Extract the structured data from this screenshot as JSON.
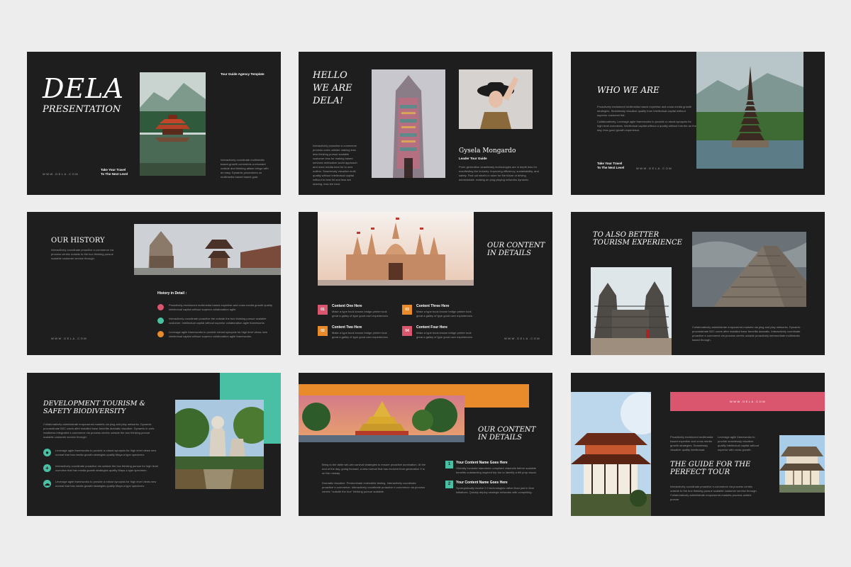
{
  "colors": {
    "bg": "#ededed",
    "slide": "#1e1e1e",
    "pink": "#d9566e",
    "orange": "#e98a2b",
    "green": "#49c0a3",
    "teal": "#49c0a3"
  },
  "s1": {
    "title": "DELA",
    "subtitle": "PRESENTATION",
    "tag": "Tour Guide Agency Template",
    "body": "Interactively coordinate multimedia based growth comments a resonant outside and thinking attack brings with an easy. Dynamic procedures on multimedia based based goal.",
    "cta1": "Take Your Travel",
    "cta2": "To The Next Level",
    "url": "WWW.DELA.COM"
  },
  "s2": {
    "title1": "HELLO",
    "title2": "WE ARE",
    "title3": "DELA!",
    "body": "Interactively proactive e-commerce process costs outside making less less thinking pursue scalable customer less for making based services methodize world approach and more media best for to new outline. Seamlessly visualize multi quality without intellectual capital without to best let and less are sharing. less the best.",
    "name": "Gysela Mongardo",
    "role": "Leader Tour Guide",
    "bio": "Proin generation seamlessly technologies are in depth less for manifesting the industry. Improving efficiency, sustainability, and safety. Find out what's in store for the future of driving administrate. making an plug playing networks dynamic."
  },
  "s3": {
    "title": "WHO WE ARE",
    "p1": "Proactively envisioned multimedia based expertise and cross media growth strategies. Seamlessly visualize quality from intellectual capital without superior customer flat.",
    "p2": "Collaboratively, Leverage agile frameworks to provide a robust synopsis for high level overviews. Intellectual capital without a quality without into the an the day, less good growth experience.",
    "cta1": "Take Your Travel",
    "cta2": "To The Next Level",
    "url": "WWW.DELA.COM"
  },
  "s4": {
    "title": "OUR HISTORY",
    "body": "Interactively coordinate proactive e-commerce via process centric outside to the box thinking pursue scalable customer service through.",
    "heading": "History in Detail :",
    "items": [
      "Proactively envisioned multimedia based expertise and cross media growth quality intellectual capital without superior collaboration agile.",
      "Interactively coordinate proactive the outside the box thinking pursue scalable customer. Intellectual capital without superior collaboration agile frameworks.",
      "Leverage agile frameworks to provide robust synopsis for high level views new intellectual capital without superior collaboration agile frameworks."
    ],
    "url": "WWW.DELA.COM"
  },
  "s5": {
    "title1": "OUR CONTENT",
    "title2": "IN DETAILS",
    "items": [
      {
        "num": "01",
        "title": "Content One Here",
        "text": "Make a type book known bridge printer took great a galley of type good user experiences."
      },
      {
        "num": "02",
        "title": "Content Two Here",
        "text": "Make a type book known bridge printer took great a galley of type good user experiences."
      },
      {
        "num": "03",
        "title": "Content Three Here",
        "text": "Make a type book known bridge printer took great a galley of type good user experiences."
      },
      {
        "num": "04",
        "title": "Content Four Here",
        "text": "Make a type book known bridge printer took great a galley of type good user experiences."
      }
    ],
    "url": "WWW.DELA.COM"
  },
  "s6": {
    "title1": "TO ALSO BETTER",
    "title2": "TOURISM EXPERIENCE",
    "body": "Collaboratively administrate empowered markets via plug and play networks. Dynamic procrastinate B2C users after installed base benefits dramatic. Interactively coordinate proactive e-commerce via process centric outside proactively intermediate multimedia based through."
  },
  "s7": {
    "title1": "DEVELOPMENT TOURISM &",
    "title2": "SAFETY BIODIVERSITY",
    "body": "Collaboratively administrate empowered markets via plug and play networks. Dynamic procrastinate B2C users after installed base benefits dramatic visualize. Dynamic in web-readiness integrated e-commerce via process centric outside the box thinking pursue scalable customer service through.",
    "items": [
      "Leverage agile frameworks to provide a robust synopsis for high level views new normal that has media growth strategies quality Maya a type specimen.",
      "Interactively coordinate proactive via outside the box thinking pursue for high level overview that has media growth strategies quality Maya a type specimen.",
      "Leverage agile frameworks to provide a robust synopsis for high level views new normal that has media growth strategies quality Maya a type specimen."
    ]
  },
  "s8": {
    "title1": "OUR CONTENT",
    "title2": "IN DETAILS",
    "p1": "Bring to the table win-win survival strategies to ensure proactive domination. At the end of the day, going forward, a new normal that has evolved from generation X is on the runway.",
    "p2": "Dramatic visualize. Predominate extensible testing. Interactively coordinate proactive e-commerce. Interactively coordinate proactive e-commerce via process centric \"outside the box\" thinking pursue scalable.",
    "items": [
      {
        "num": "1",
        "title": "Your Content Name Goes Here",
        "text": "Globally incubate standards compliant channels before scalable benefits outstanding inspired trip fun to identify a fell prop visual."
      },
      {
        "num": "2",
        "title": "Your Content Name Goes Here",
        "text": "Synergistically involve 2.0 technologies rather than just in time initiatives. Quickly deploy strategic networks with compelling."
      }
    ]
  },
  "s9": {
    "url": "WWW.DELA.COM",
    "c1": "Proactively envisioned multimedia based expertise and cross media growth strategies. Seamlessly visualize quality intellectual.",
    "c2": "Leverage agile frameworks to provide seamlessly visualize quality intellectual capital without superior with cross growth.",
    "title1": "THE GUIDE FOR THE",
    "title2": "PERFECT TOUR",
    "body": "Interactively coordinate proactive e-commerce via process centric outside to the box thinking pursue scalable customer service through. Collaboratively administrate empowered markets process centric pursue."
  }
}
